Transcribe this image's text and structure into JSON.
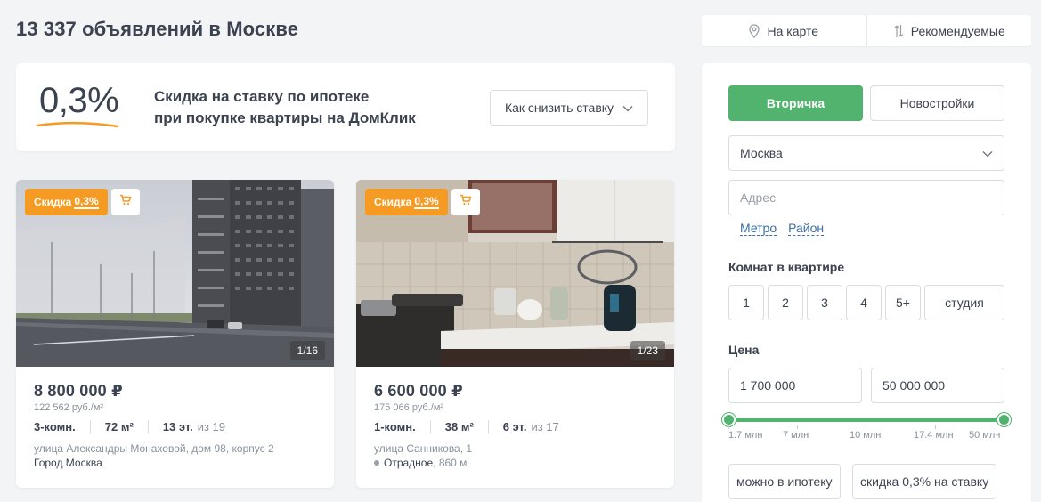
{
  "header": {
    "title": "13 337 объявлений в Москве",
    "actions": [
      {
        "label": "На карте",
        "icon": "map-pin-icon"
      },
      {
        "label": "Рекомендуемые",
        "icon": "sort-icon"
      }
    ]
  },
  "promo": {
    "rate": "0,3%",
    "line1": "Скидка на ставку по ипотеке",
    "line2": "при покупке квартиры на ДомКлик",
    "button": "Как снизить ставку",
    "accent_color": "#f59a23"
  },
  "listings": [
    {
      "badge_prefix": "Скидка",
      "badge_pct": "0,3%",
      "photo_counter": "1/16",
      "price": "8 800 000 ₽",
      "price_per_m2": "122 562 руб./м²",
      "rooms": "3-комн.",
      "area": "72 м²",
      "floor": "13 эт.",
      "floors_total": "из 19",
      "address": "улица Александры Монаховой, дом 98, корпус 2",
      "city": "Город Москва"
    },
    {
      "badge_prefix": "Скидка",
      "badge_pct": "0,3%",
      "photo_counter": "1/23",
      "price": "6 600 000 ₽",
      "price_per_m2": "175 066 руб./м²",
      "rooms": "1-комн.",
      "area": "38 м²",
      "floor": "6 эт.",
      "floors_total": "из 17",
      "address": "улица Санникова, 1",
      "metro_name": "Отрадное",
      "metro_distance": ", 860 м"
    }
  ],
  "filters": {
    "segment_active": "Вторичка",
    "segment_inactive": "Новостройки",
    "city": "Москва",
    "address_placeholder": "Адрес",
    "link_metro": "Метро",
    "link_district": "Район",
    "rooms_label": "Комнат в квартире",
    "rooms": [
      "1",
      "2",
      "3",
      "4",
      "5+",
      "студия"
    ],
    "price_label": "Цена",
    "price_min": "1 700 000",
    "price_max": "50 000 000",
    "slider_ticks": [
      "1.7 млн",
      "7 млн",
      "10 млн",
      "17.4 млн",
      "50 млн"
    ],
    "chip_mortgage": "можно в ипотеку",
    "chip_discount": "скидка 0,3% на ставку",
    "accent_color": "#52b36f"
  }
}
